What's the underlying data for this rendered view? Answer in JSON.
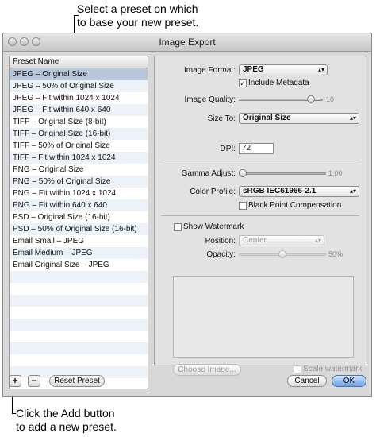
{
  "callouts": {
    "top_line1": "Select a preset on which",
    "top_line2": "to base your new preset.",
    "bottom_line1": "Click the Add button",
    "bottom_line2": "to add a new preset."
  },
  "window": {
    "title": "Image Export"
  },
  "preset_list": {
    "header": "Preset Name",
    "selected_index": 0,
    "items": [
      "JPEG – Original Size",
      "JPEG – 50% of Original Size",
      "JPEG – Fit within 1024 x 1024",
      "JPEG – Fit within 640 x 640",
      "TIFF – Original Size (8-bit)",
      "TIFF – Original Size (16-bit)",
      "TIFF – 50% of Original Size",
      "TIFF – Fit within 1024 x 1024",
      "PNG – Original Size",
      "PNG – 50% of Original Size",
      "PNG – Fit within 1024 x 1024",
      "PNG – Fit within 640 x 640",
      "PSD – Original Size (16-bit)",
      "PSD – 50% of Original Size (16-bit)",
      "Email Small – JPEG",
      "Email Medium – JPEG",
      "Email Original Size – JPEG"
    ]
  },
  "settings": {
    "image_format_label": "Image Format:",
    "image_format_value": "JPEG",
    "include_metadata_label": "Include Metadata",
    "image_quality_label": "Image Quality:",
    "image_quality_value": "10",
    "image_quality_level": 0.9,
    "size_to_label": "Size To:",
    "size_to_value": "Original Size",
    "dpi_label": "DPI:",
    "dpi_value": "72",
    "gamma_label": "Gamma Adjust:",
    "gamma_value": "1.00",
    "gamma_level": 0.0,
    "color_profile_label": "Color Profile:",
    "color_profile_value": "sRGB IEC61966-2.1",
    "black_point_label": "Black Point Compensation",
    "show_watermark_label": "Show Watermark",
    "position_label": "Position:",
    "position_value": "Center",
    "opacity_label": "Opacity:",
    "opacity_value": "50%",
    "opacity_level": 0.5,
    "choose_image_label": "Choose Image...",
    "scale_watermark_label": "Scale watermark"
  },
  "footer": {
    "add_label": "+",
    "remove_label": "−",
    "reset_label": "Reset Preset",
    "cancel_label": "Cancel",
    "ok_label": "OK"
  },
  "icons": {
    "checkmark": "✓",
    "popup_arrows": "▴▾"
  }
}
